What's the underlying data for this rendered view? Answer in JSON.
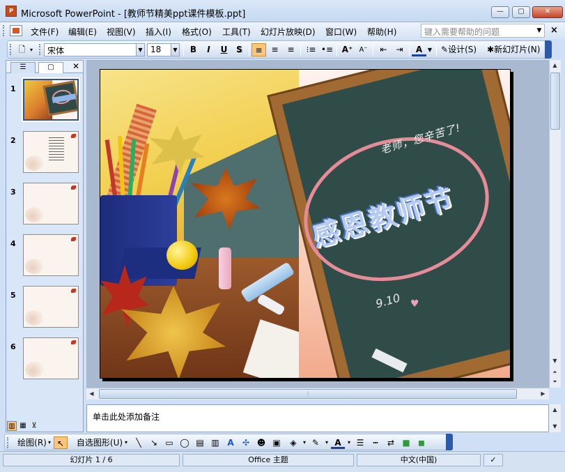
{
  "window": {
    "title": "Microsoft PowerPoint - [教师节精美ppt课件模板.ppt]",
    "app_icon_label": "P",
    "buttons": {
      "minimize": "—",
      "maximize": "▢",
      "close": "✕"
    }
  },
  "menu": {
    "items": [
      "文件(F)",
      "编辑(E)",
      "视图(V)",
      "插入(I)",
      "格式(O)",
      "工具(T)",
      "幻灯片放映(D)",
      "窗口(W)",
      "帮助(H)"
    ],
    "help_placeholder": "键入需要帮助的问题",
    "close_glyph": "×"
  },
  "format_toolbar": {
    "font": "宋体",
    "size": "18",
    "bold": "B",
    "italic": "I",
    "underline": "U",
    "shadow": "S",
    "design_label": "设计(S)",
    "new_slide_label": "新幻灯片(N)"
  },
  "left_panel": {
    "tab_outline": "☰",
    "tab_slides": "▢",
    "close_glyph": "✕",
    "slides": [
      {
        "number": "1",
        "selected": true
      },
      {
        "number": "2",
        "selected": false
      },
      {
        "number": "3",
        "selected": false
      },
      {
        "number": "4",
        "selected": false
      },
      {
        "number": "5",
        "selected": false
      },
      {
        "number": "6",
        "selected": false
      }
    ]
  },
  "slide": {
    "subtitle": "老师，您辛苦了!",
    "title": "感恩教师节",
    "date": "9.10",
    "heart": "♥"
  },
  "notes": {
    "placeholder": "单击此处添加备注"
  },
  "draw_toolbar": {
    "draw_label": "绘图(R)",
    "autoshape_label": "自选图形(U)"
  },
  "status": {
    "slide_info": "幻灯片 1 / 6",
    "theme": "Office 主题",
    "language": "中文(中国)"
  },
  "colors": {
    "board_green": "#2f4c49",
    "title_blue": "#b4cbf3",
    "heart_pink": "#e58c98",
    "accent_active": "#ffc57a"
  }
}
